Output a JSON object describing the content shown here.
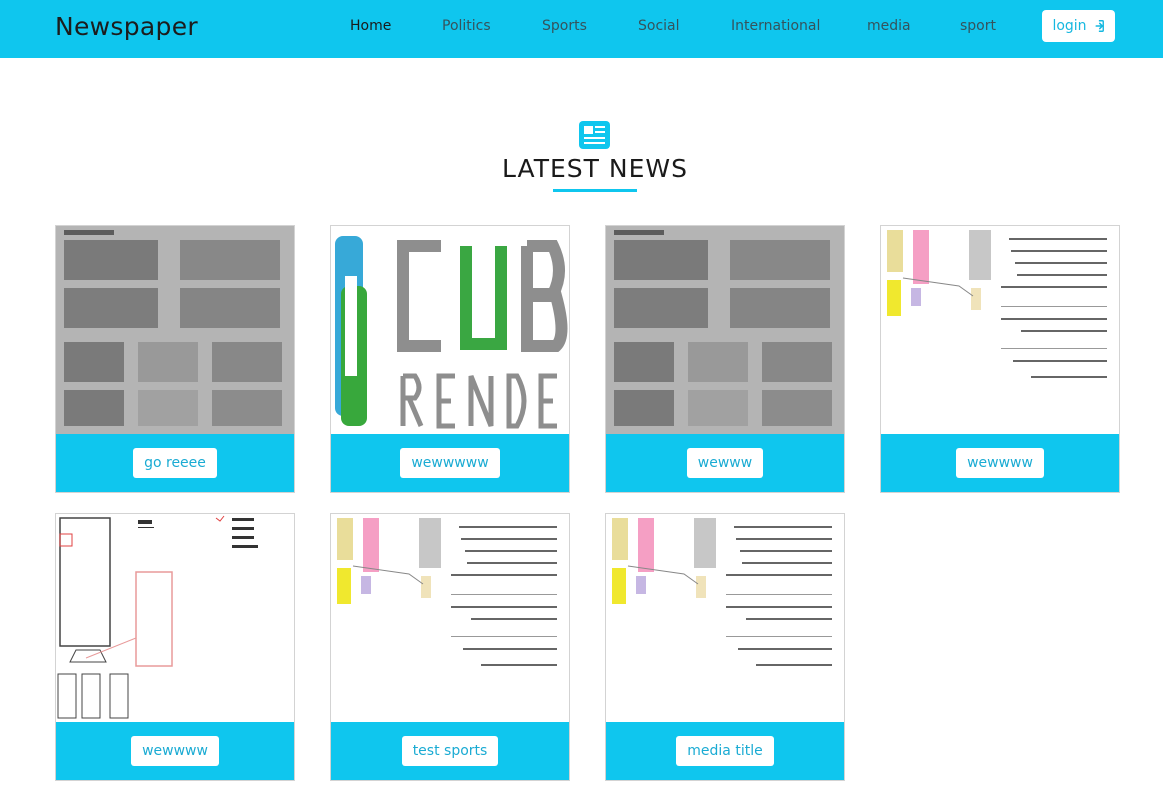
{
  "header": {
    "brand": "Newspaper",
    "nav": [
      "Home",
      "Politics",
      "Sports",
      "Social",
      "International",
      "media",
      "sport"
    ],
    "login_label": "login"
  },
  "main": {
    "section_title": "LATEST NEWS",
    "cards": [
      {
        "title": "go reeee",
        "image": "grammar-worksheet"
      },
      {
        "title": "wewwwww",
        "image": "cube-render-logo"
      },
      {
        "title": "wewww",
        "image": "grammar-worksheet"
      },
      {
        "title": "wewwww",
        "image": "network-diagram-document"
      },
      {
        "title": "wewwww",
        "image": "boot-menu-sketch"
      },
      {
        "title": "test sports",
        "image": "network-diagram-document"
      },
      {
        "title": "media title",
        "image": "network-diagram-document"
      }
    ]
  },
  "colors": {
    "accent": "#0fc6ee",
    "link": "#1aabd3"
  }
}
